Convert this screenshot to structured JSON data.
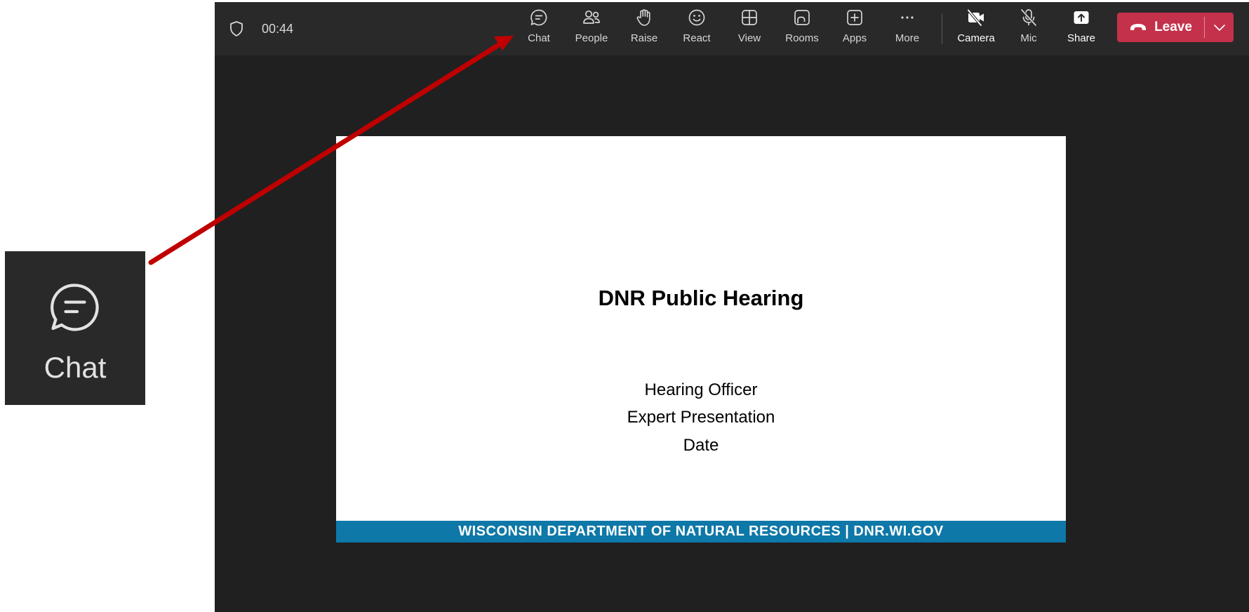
{
  "meeting": {
    "timer": "00:44",
    "toolbar": [
      {
        "name": "chat",
        "label": "Chat",
        "icon": "chat-icon"
      },
      {
        "name": "people",
        "label": "People",
        "icon": "people-icon"
      },
      {
        "name": "raise",
        "label": "Raise",
        "icon": "raise-hand-icon"
      },
      {
        "name": "react",
        "label": "React",
        "icon": "smiley-icon"
      },
      {
        "name": "view",
        "label": "View",
        "icon": "grid-icon"
      },
      {
        "name": "rooms",
        "label": "Rooms",
        "icon": "rooms-icon"
      },
      {
        "name": "apps",
        "label": "Apps",
        "icon": "plus-box-icon"
      },
      {
        "name": "more",
        "label": "More",
        "icon": "ellipsis-icon"
      },
      {
        "name": "camera",
        "label": "Camera",
        "icon": "camera-off-icon"
      },
      {
        "name": "mic",
        "label": "Mic",
        "icon": "mic-off-icon"
      },
      {
        "name": "share",
        "label": "Share",
        "icon": "share-icon"
      }
    ],
    "leave_label": "Leave",
    "leave_color": "#c4314b"
  },
  "slide": {
    "title": "DNR Public Hearing",
    "lines": [
      "Hearing Officer",
      "Expert Presentation",
      "Date"
    ],
    "footer": "WISCONSIN DEPARTMENT OF NATURAL RESOURCES | DNR.WI.GOV",
    "footer_color": "#0e78a8"
  },
  "callout": {
    "label": "Chat",
    "icon": "chat-icon",
    "arrow_color": "#c00000"
  }
}
